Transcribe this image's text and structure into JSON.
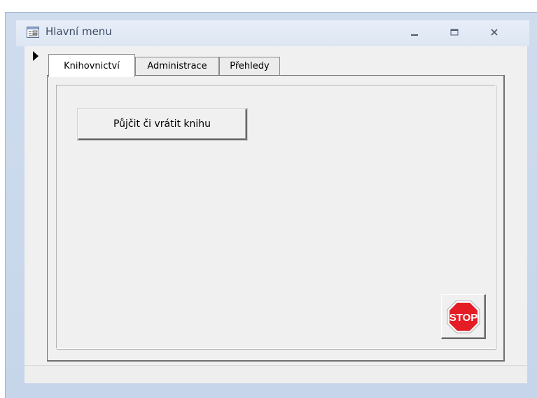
{
  "window": {
    "title": "Hlavní menu",
    "icon": "form-icon",
    "controls": {
      "minimize": "minimize-icon",
      "maximize": "maximize-icon",
      "close": "close-icon"
    }
  },
  "tabs": [
    {
      "label": "Knihovnictví",
      "active": true
    },
    {
      "label": "Administrace",
      "active": false
    },
    {
      "label": "Přehledy",
      "active": false
    }
  ],
  "main": {
    "lend_button_label": "Půjčit či vrátit knihu",
    "stop_button": {
      "label": "STOP",
      "icon": "stop-sign-icon"
    }
  },
  "colors": {
    "frame": "#c6d5ea",
    "title_bar": "#dde6f3",
    "form_background": "#f0f0f0",
    "stop_red": "#e41c24"
  }
}
